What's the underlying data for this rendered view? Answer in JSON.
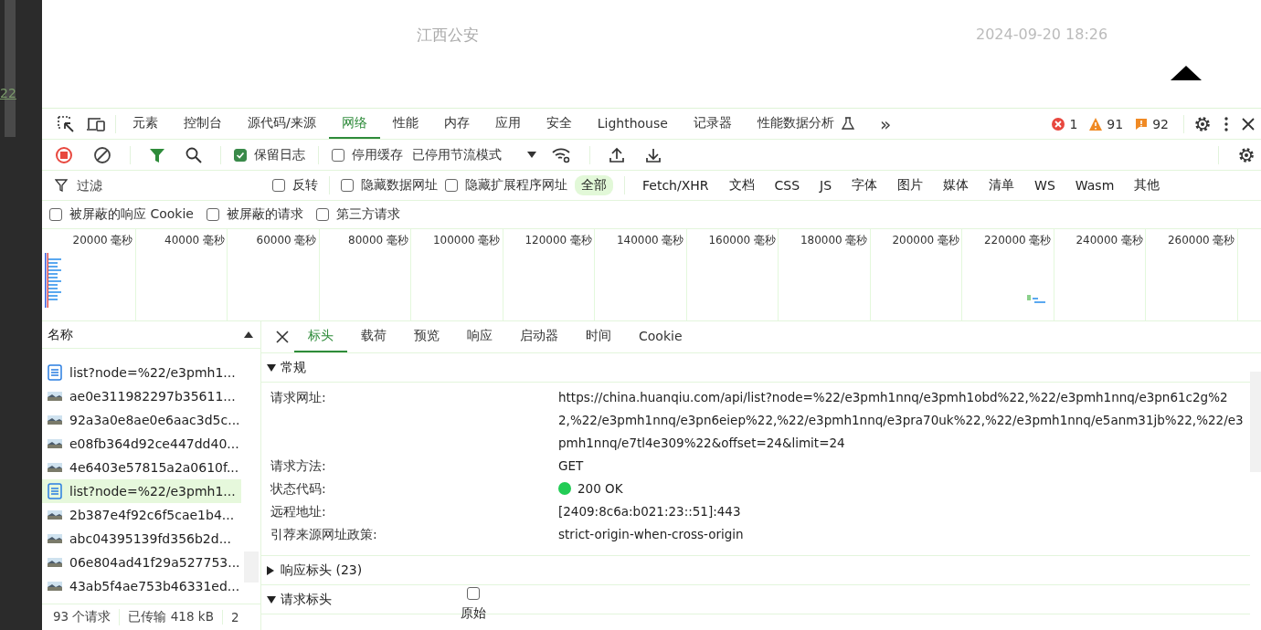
{
  "editor_strip": {
    "line_number": "22"
  },
  "page": {
    "source": "江西公安",
    "time": "2024-09-20 18:26"
  },
  "devtools": {
    "tabs": [
      {
        "label": "元素",
        "selected": false
      },
      {
        "label": "控制台",
        "selected": false
      },
      {
        "label": "源代码/来源",
        "selected": false
      },
      {
        "label": "网络",
        "selected": true
      },
      {
        "label": "性能",
        "selected": false
      },
      {
        "label": "内存",
        "selected": false
      },
      {
        "label": "应用",
        "selected": false
      },
      {
        "label": "安全",
        "selected": false
      },
      {
        "label": "Lighthouse",
        "selected": false
      },
      {
        "label": "记录器",
        "selected": false
      },
      {
        "label": "性能数据分析",
        "selected": false,
        "kind": "experimental"
      }
    ],
    "more_tabs": "»",
    "issues": {
      "errors": "1",
      "warnings": "91",
      "info": "92"
    },
    "toolbar": {
      "recording": true,
      "filter_active": true,
      "checkboxes": [
        {
          "label": "保留日志",
          "checked": true
        },
        {
          "label": "停用缓存",
          "checked": false
        }
      ],
      "throttling": "已停用节流模式"
    },
    "filter": {
      "placeholder": "过滤",
      "checkboxes": [
        {
          "label": "反转",
          "checked": false
        },
        {
          "label": "隐藏数据网址",
          "checked": false
        },
        {
          "label": "隐藏扩展程序网址",
          "checked": false
        }
      ],
      "types": [
        {
          "label": "全部",
          "selected": true
        },
        {
          "label": "Fetch/XHR",
          "selected": false
        },
        {
          "label": "文档",
          "selected": false
        },
        {
          "label": "CSS",
          "selected": false
        },
        {
          "label": "JS",
          "selected": false
        },
        {
          "label": "字体",
          "selected": false
        },
        {
          "label": "图片",
          "selected": false
        },
        {
          "label": "媒体",
          "selected": false
        },
        {
          "label": "清单",
          "selected": false
        },
        {
          "label": "WS",
          "selected": false
        },
        {
          "label": "Wasm",
          "selected": false
        },
        {
          "label": "其他",
          "selected": false
        }
      ]
    },
    "extra_filters": [
      {
        "label": "被屏蔽的响应 Cookie",
        "checked": false
      },
      {
        "label": "被屏蔽的请求",
        "checked": false
      },
      {
        "label": "第三方请求",
        "checked": false
      }
    ],
    "timeline": {
      "ticks": [
        "20000 毫秒",
        "40000 毫秒",
        "60000 毫秒",
        "80000 毫秒",
        "100000 毫秒",
        "120000 毫秒",
        "140000 毫秒",
        "160000 毫秒",
        "180000 毫秒",
        "200000 毫秒",
        "220000 毫秒",
        "240000 毫秒",
        "260000 毫秒"
      ]
    },
    "requests": {
      "header": "名称",
      "items": [
        {
          "name": "list?node=%22/e3pmh1...",
          "kind": "document",
          "selected": false
        },
        {
          "name": "ae0e311982297b35611...",
          "selected": false
        },
        {
          "name": "92a3a0e8ae0e6aac3d5c...",
          "selected": false
        },
        {
          "name": "e08fb364d92ce447dd40...",
          "selected": false
        },
        {
          "name": "4e6403e57815a2a0610f...",
          "selected": false
        },
        {
          "name": "list?node=%22/e3pmh1...",
          "kind": "document",
          "selected": true
        },
        {
          "name": "2b387e4f92c6f5cae1b4...",
          "selected": false
        },
        {
          "name": "abc04395139fd356b2d...",
          "selected": false
        },
        {
          "name": "06e804ad41f29a527753...",
          "selected": false
        },
        {
          "name": "43ab5f4ae753b46331ed...",
          "selected": false
        }
      ]
    },
    "summary": [
      "93 个请求",
      "已传输 418 kB",
      "2"
    ],
    "detail": {
      "tabs": [
        {
          "label": "标头",
          "selected": true
        },
        {
          "label": "载荷",
          "selected": false
        },
        {
          "label": "预览",
          "selected": false
        },
        {
          "label": "响应",
          "selected": false
        },
        {
          "label": "启动器",
          "selected": false
        },
        {
          "label": "时间",
          "selected": false
        },
        {
          "label": "Cookie",
          "selected": false
        }
      ],
      "sections": [
        {
          "title": "常规",
          "expanded": true,
          "rows": [
            {
              "label": "请求网址:",
              "value": "https://china.huanqiu.com/api/list?node=%22/e3pmh1nnq/e3pmh1obd%22,%22/e3pmh1nnq/e3pn61c2g%22,%22/e3pmh1nnq/e3pn6eiep%22,%22/e3pmh1nnq/e3pra70uk%22,%22/e3pmh1nnq/e5anm31jb%22,%22/e3pmh1nnq/e7tl4e309%22&offset=24&limit=24"
            },
            {
              "label": "请求方法:",
              "value": "GET"
            },
            {
              "label": "状态代码:",
              "value": "200 OK",
              "color": "#22cc55"
            },
            {
              "label": "远程地址:",
              "value": "[2409:8c6a:b021:23::51]:443"
            },
            {
              "label": "引荐来源网址政策:",
              "value": "strict-origin-when-cross-origin"
            }
          ]
        },
        {
          "title": "响应标头 (23)",
          "expanded": false
        },
        {
          "title": "请求标头",
          "expanded": true,
          "raw": {
            "label": "原始",
            "checked": false
          }
        }
      ]
    }
  }
}
